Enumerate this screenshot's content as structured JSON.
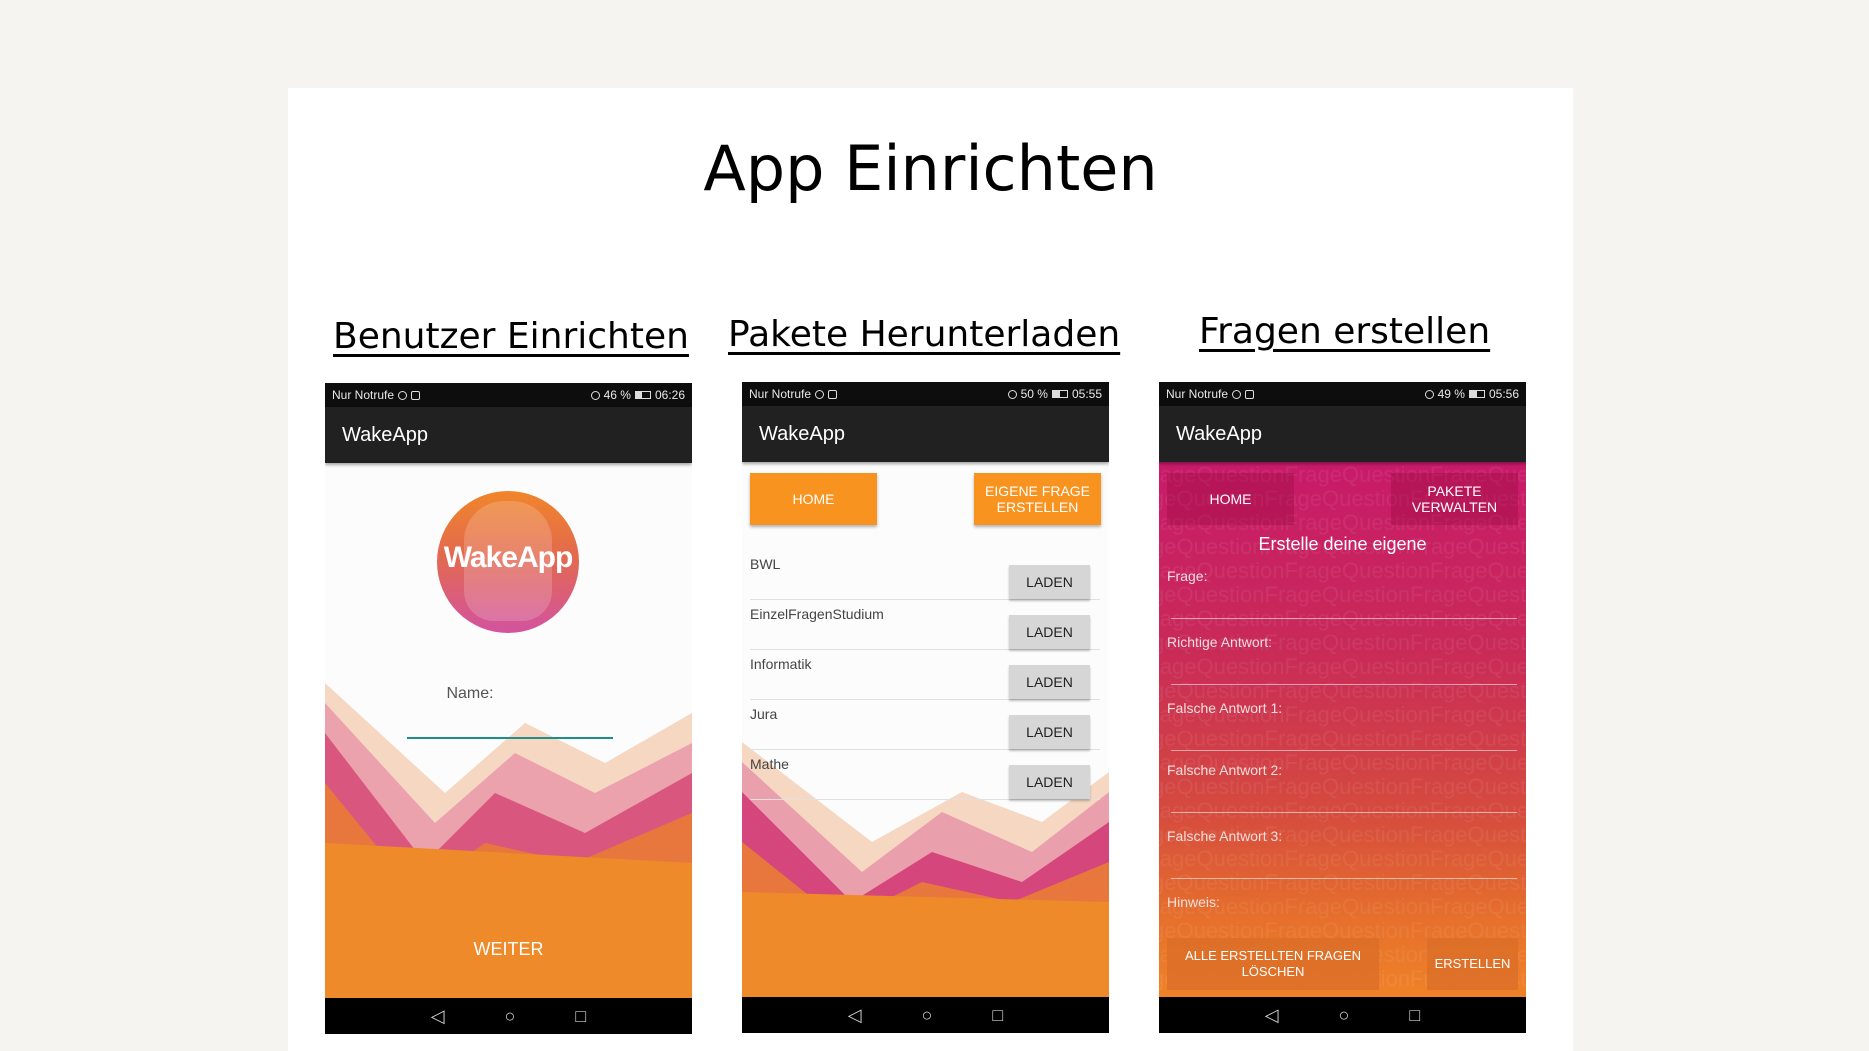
{
  "slide": {
    "title": "App Einrichten",
    "columns": [
      "Benutzer Einrichten",
      "Pakete Herunterladen",
      "Fragen erstellen"
    ]
  },
  "phones": [
    {
      "status_left": "Nur Notrufe",
      "status_battery": "46 %",
      "status_time": "06:26",
      "app_title": "WakeApp",
      "logo_text": "WakeApp",
      "name_label": "Name:",
      "name_value": "",
      "weiter_label": "WEITER"
    },
    {
      "status_left": "Nur Notrufe",
      "status_battery": "50 %",
      "status_time": "05:55",
      "app_title": "WakeApp",
      "home_label": "HOME",
      "eigene_frage_label": "EIGENE FRAGE ERSTELLEN",
      "packages": [
        {
          "name": "BWL",
          "button": "LADEN"
        },
        {
          "name": "EinzelFragenStudium",
          "button": "LADEN"
        },
        {
          "name": "Informatik",
          "button": "LADEN"
        },
        {
          "name": "Jura",
          "button": "LADEN"
        },
        {
          "name": "Mathe",
          "button": "LADEN"
        }
      ]
    },
    {
      "status_left": "Nur Notrufe",
      "status_battery": "49 %",
      "status_time": "05:56",
      "app_title": "WakeApp",
      "home_label": "HOME",
      "pakete_label": "PAKETE VERWALTEN",
      "subtitle": "Erstelle deine eigene",
      "fields": [
        "Frage:",
        "Richtige Antwort:",
        "Falsche Antwort 1:",
        "Falsche Antwort 2:",
        "Falsche Antwort 3:",
        "Hinweis:"
      ],
      "delete_all_label": "ALLE ERSTELLTEN FRAGEN LÖSCHEN",
      "create_label": "ERSTELLEN",
      "watermark": "FrageQuestionFrageQuestionFrageQuestionFrageQuestion"
    }
  ],
  "nav_icons": [
    "back-icon",
    "home-circle-icon",
    "recents-square-icon"
  ],
  "colors": {
    "accent_orange": "#f7931e",
    "appbar": "#212121",
    "input_underline": "#1f8e8a",
    "magenta": "#c81a6a"
  }
}
